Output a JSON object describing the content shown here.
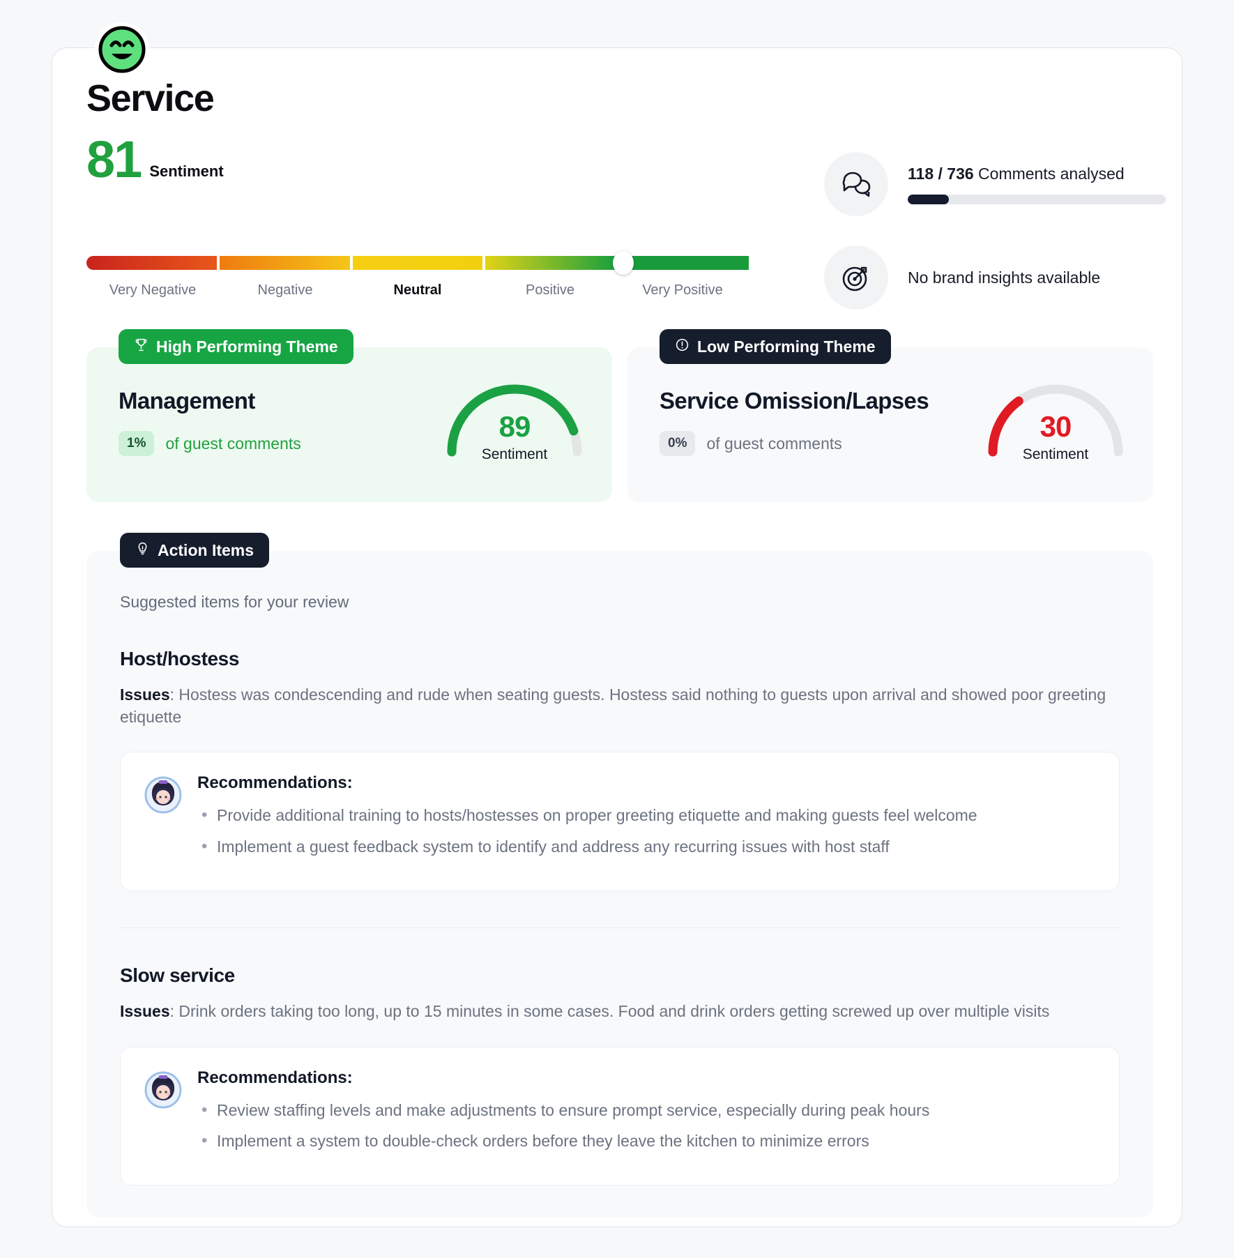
{
  "header": {
    "icon": "happy-face-icon",
    "title": "Service",
    "sentiment_score": "81",
    "sentiment_label": "Sentiment"
  },
  "scale": {
    "labels": [
      "Very Negative",
      "Negative",
      "Neutral",
      "Positive",
      "Very Positive"
    ],
    "active_label": "Neutral",
    "thumb_position_pct": 81
  },
  "stats": {
    "comments": {
      "icon": "comments-icon",
      "count": "118 / 736",
      "text": " Comments analysed",
      "progress_pct": 16
    },
    "brand": {
      "icon": "target-icon",
      "text": "No brand insights available"
    }
  },
  "themes": [
    {
      "tag": "High Performing Theme",
      "tag_icon": "trophy-icon",
      "name": "Management",
      "pct": "1%",
      "pct_label": "of guest comments",
      "gauge_value": "89",
      "gauge_label": "Sentiment",
      "color": "#1ba043"
    },
    {
      "tag": "Low Performing Theme",
      "tag_icon": "alert-circle-icon",
      "name": "Service Omission/Lapses",
      "pct": "0%",
      "pct_label": "of guest comments",
      "gauge_value": "30",
      "gauge_label": "Sentiment",
      "color": "#e01b24"
    }
  ],
  "action_items": {
    "tag": "Action Items",
    "tag_icon": "lightbulb-icon",
    "subtitle": "Suggested items for your review",
    "items": [
      {
        "title": "Host/hostess",
        "issues_label": "Issues",
        "issues_text": ": Hostess was condescending and rude when seating guests. Hostess said nothing to guests upon arrival and showed poor greeting etiquette",
        "recs_title": "Recommendations:",
        "recs": [
          "Provide additional training to hosts/hostesses on proper greeting etiquette and making guests feel welcome",
          "Implement a guest feedback system to identify and address any recurring issues with host staff"
        ]
      },
      {
        "title": "Slow service",
        "issues_label": "Issues",
        "issues_text": ": Drink orders taking too long, up to 15 minutes in some cases. Food and drink orders getting screwed up over multiple visits",
        "recs_title": "Recommendations:",
        "recs": [
          "Review staffing levels and make adjustments to ensure prompt service, especially during peak hours",
          "Implement a system to double-check orders before they leave the kitchen to minimize errors"
        ]
      }
    ]
  },
  "colors": {
    "positive": "#21a03f",
    "negative": "#e01b24",
    "dark": "#161d2c"
  }
}
